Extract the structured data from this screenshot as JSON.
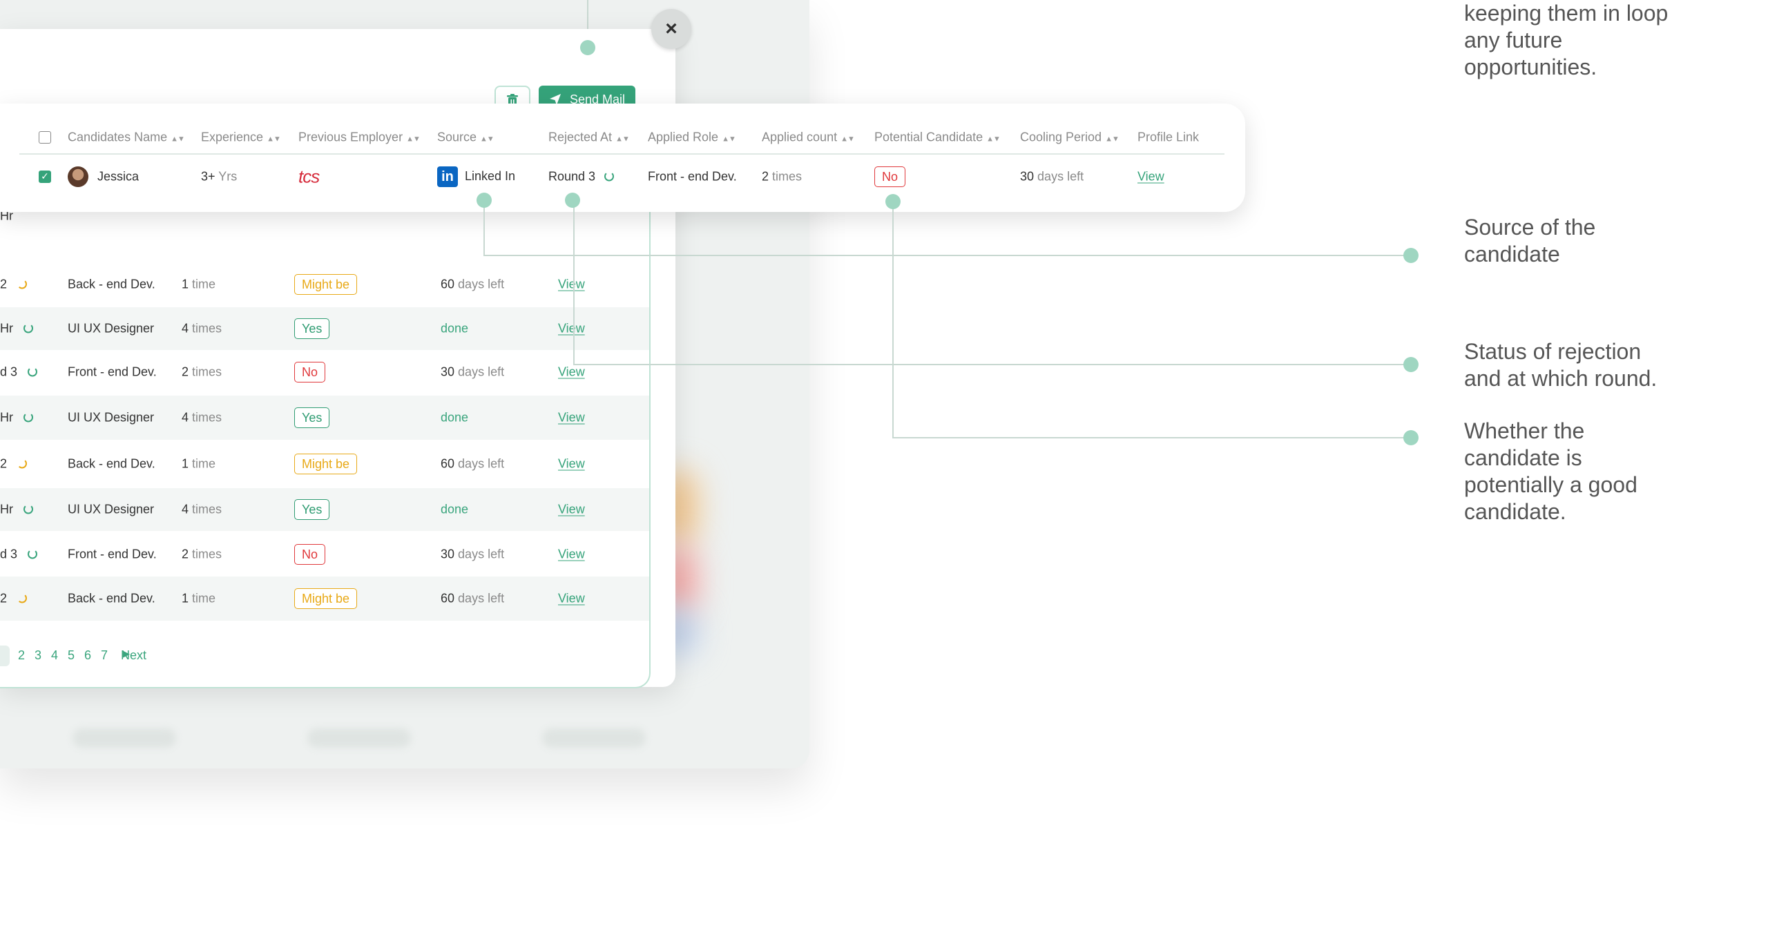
{
  "modal": {
    "close_label": "×",
    "send_mail_label": "Send Mail",
    "icons": {
      "close": "close-icon",
      "delete": "trash-icon",
      "send": "paper-plane-icon"
    }
  },
  "table": {
    "columns": [
      "Candidates Name",
      "Experience",
      "Previous Employer",
      "Source",
      "Rejected At",
      "Applied Role",
      "Applied count",
      "Potential Candidate",
      "Cooling Period",
      "Profile Link"
    ],
    "selected_row": {
      "name": "Jessica",
      "experience_num": "3+",
      "experience_unit": "Yrs",
      "employer": "tcs",
      "source": "Linked In",
      "rejected_at": "Round 3",
      "role": "Front - end Dev.",
      "count_num": "2",
      "count_unit": "times",
      "potential": "No",
      "cooling_num": "30",
      "cooling_unit": "days left",
      "link": "View"
    },
    "partial_top_row": {
      "stage": "Hr"
    },
    "rows": [
      {
        "stage": "2",
        "role": "Back - end Dev.",
        "count_num": "1",
        "count_unit": "time",
        "potential": "Might be",
        "cooling_num": "60",
        "cooling_unit": "days left",
        "link": "View"
      },
      {
        "stage": "Hr",
        "role": "UI UX Designer",
        "count_num": "4",
        "count_unit": "times",
        "potential": "Yes",
        "cooling_num": "",
        "cooling_unit": "done",
        "link": "View"
      },
      {
        "stage": "d 3",
        "role": "Front - end Dev.",
        "count_num": "2",
        "count_unit": "times",
        "potential": "No",
        "cooling_num": "30",
        "cooling_unit": "days left",
        "link": "View"
      },
      {
        "stage": "Hr",
        "role": "UI UX Designer",
        "count_num": "4",
        "count_unit": "times",
        "potential": "Yes",
        "cooling_num": "",
        "cooling_unit": "done",
        "link": "View"
      },
      {
        "stage": "2",
        "role": "Back - end Dev.",
        "count_num": "1",
        "count_unit": "time",
        "potential": "Might be",
        "cooling_num": "60",
        "cooling_unit": "days left",
        "link": "View"
      },
      {
        "stage": "Hr",
        "role": "UI UX Designer",
        "count_num": "4",
        "count_unit": "times",
        "potential": "Yes",
        "cooling_num": "",
        "cooling_unit": "done",
        "link": "View"
      },
      {
        "stage": "d 3",
        "role": "Front - end Dev.",
        "count_num": "2",
        "count_unit": "times",
        "potential": "No",
        "cooling_num": "30",
        "cooling_unit": "days left",
        "link": "View"
      },
      {
        "stage": "2",
        "role": "Back - end Dev.",
        "count_num": "1",
        "count_unit": "time",
        "potential": "Might be",
        "cooling_num": "60",
        "cooling_unit": "days left",
        "link": "View"
      }
    ]
  },
  "pagination": {
    "pages": [
      "2",
      "3",
      "4",
      "5",
      "6",
      "7"
    ],
    "next_label": "Next"
  },
  "callouts": {
    "top": "keeping them in loop any future opportunities.",
    "source": "Source of the candidate",
    "rejection": "Status of rejection and at which round.",
    "potential": "Whether the candidate is potentially a good candidate."
  },
  "colors": {
    "accent": "#35a37a",
    "no": "#e0383b",
    "maybe": "#e8a917",
    "linkedin": "#0a66c2"
  }
}
